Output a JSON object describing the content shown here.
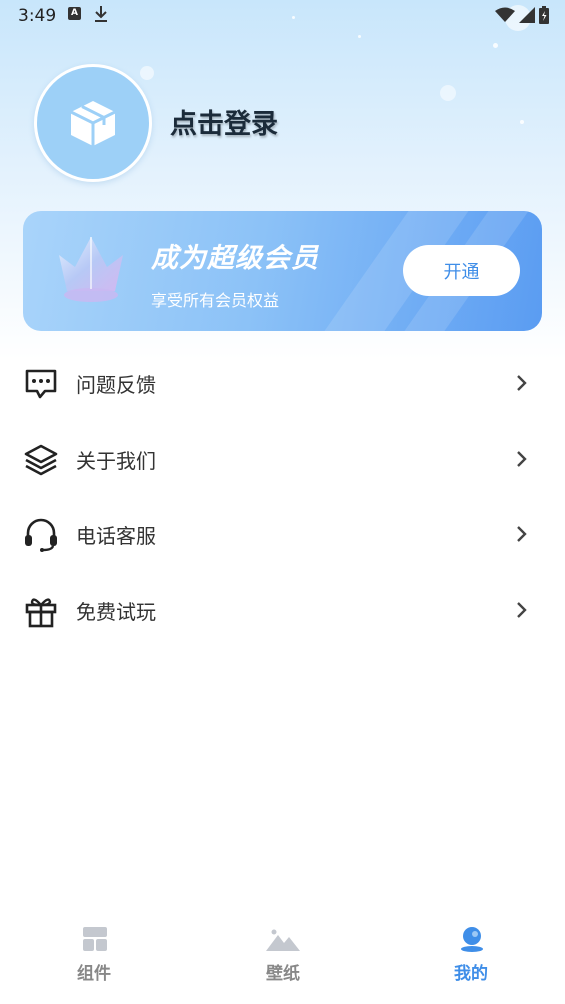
{
  "status_bar": {
    "time": "3:49",
    "a_icon": "A"
  },
  "profile": {
    "login_text": "点击登录",
    "avatar_icon": "box-icon"
  },
  "vip": {
    "title": "成为超级会员",
    "subtitle": "享受所有会员权益",
    "button_label": "开通"
  },
  "menu": [
    {
      "label": "问题反馈",
      "icon": "message-icon"
    },
    {
      "label": "关于我们",
      "icon": "layers-icon"
    },
    {
      "label": "电话客服",
      "icon": "headset-icon"
    },
    {
      "label": "免费试玩",
      "icon": "gift-icon"
    }
  ],
  "tabs": [
    {
      "label": "组件",
      "icon": "widget-icon",
      "active": false
    },
    {
      "label": "壁纸",
      "icon": "mountain-image-icon",
      "active": false
    },
    {
      "label": "我的",
      "icon": "user-icon",
      "active": true
    }
  ],
  "colors": {
    "accent": "#3f8ee8",
    "inactive": "#888888"
  }
}
